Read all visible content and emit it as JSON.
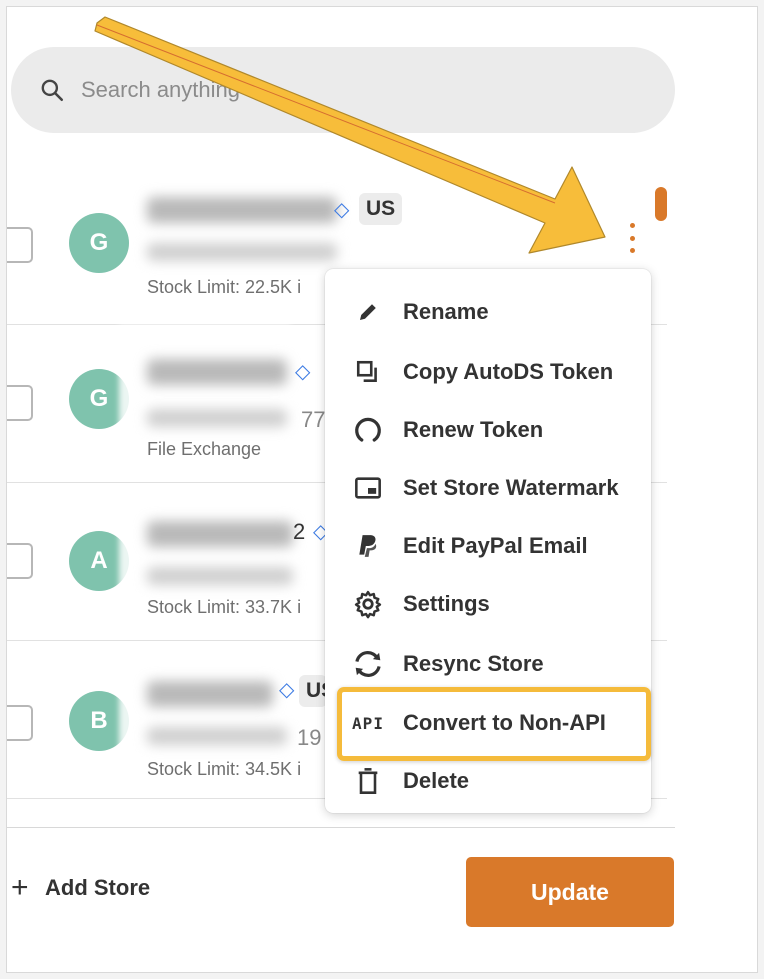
{
  "search": {
    "placeholder": "Search anything"
  },
  "stores": [
    {
      "avatar_letter": "G",
      "country": "US",
      "meta": "Stock Limit: 22.5K i"
    },
    {
      "avatar_letter": "G",
      "peek_value": "77",
      "meta": "File Exchange"
    },
    {
      "avatar_letter": "A",
      "peek_value": "2",
      "meta": "Stock Limit: 33.7K i"
    },
    {
      "avatar_letter": "B",
      "country": "US",
      "peek_value": "19",
      "meta": "Stock Limit: 34.5K i"
    }
  ],
  "menu": {
    "items": [
      {
        "label": "Rename",
        "icon": "pencil-icon"
      },
      {
        "label": "Copy AutoDS Token",
        "icon": "copy-icon"
      },
      {
        "label": "Renew Token",
        "icon": "renew-icon"
      },
      {
        "label": "Set Store Watermark",
        "icon": "watermark-icon"
      },
      {
        "label": "Edit PayPal Email",
        "icon": "paypal-icon"
      },
      {
        "label": "Settings",
        "icon": "gear-icon"
      },
      {
        "label": "Resync Store",
        "icon": "sync-icon"
      },
      {
        "label": "Convert to Non-API",
        "icon": "api-icon",
        "icon_text": "API"
      },
      {
        "label": "Delete",
        "icon": "trash-icon"
      }
    ]
  },
  "footer": {
    "add_store_label": "Add Store",
    "update_label": "Update"
  },
  "colors": {
    "accent": "#d9792a",
    "avatar": "#7fc3ad",
    "highlight": "#f5bb3b",
    "arrow": "#f7bd3a"
  }
}
